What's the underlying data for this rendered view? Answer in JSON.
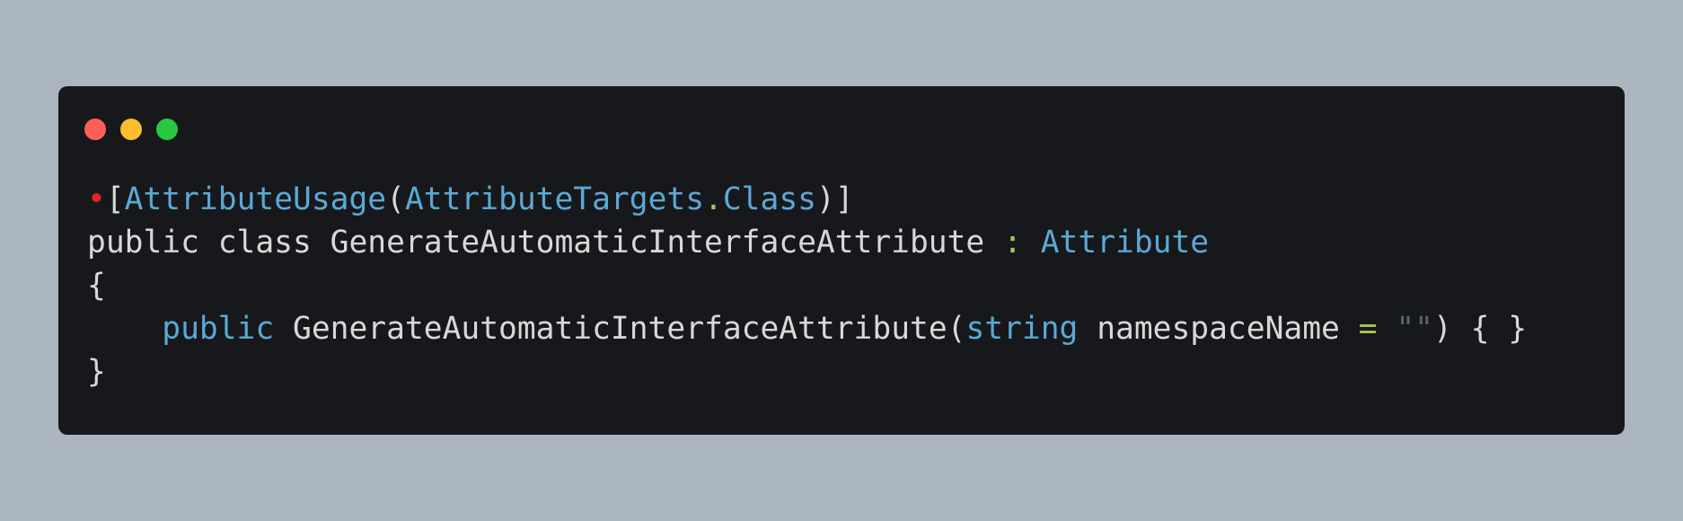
{
  "window": {
    "controls": {
      "close": "red-dot",
      "minimize": "yellow-dot",
      "maximize": "green-dot"
    }
  },
  "code": {
    "line1": {
      "bullet": "•",
      "open_bracket": "[",
      "attr": "AttributeUsage",
      "open_paren": "(",
      "enum": "AttributeTargets",
      "dot": ".",
      "member": "Class",
      "close": ")]"
    },
    "line2": {
      "decl": "public class GenerateAutomaticInterfaceAttribute ",
      "colon": ":",
      "space": " ",
      "base": "Attribute"
    },
    "line3": {
      "brace": "{"
    },
    "line4": {
      "indent": "    ",
      "kw_public": "public",
      "ctor": " GenerateAutomaticInterfaceAttribute(",
      "kw_string": "string",
      "param": " namespaceName ",
      "equals": "=",
      "space": " ",
      "str": "\"\"",
      "rest": ") { }"
    },
    "line5": {
      "brace": "}"
    }
  },
  "colors": {
    "background": "#abb5c0",
    "editor": "#17181b",
    "text": "#d8d8d8",
    "type": "#5aa9d4",
    "accent_green": "#a7c65b",
    "string": "#5c6370",
    "bullet": "#e0242a"
  }
}
